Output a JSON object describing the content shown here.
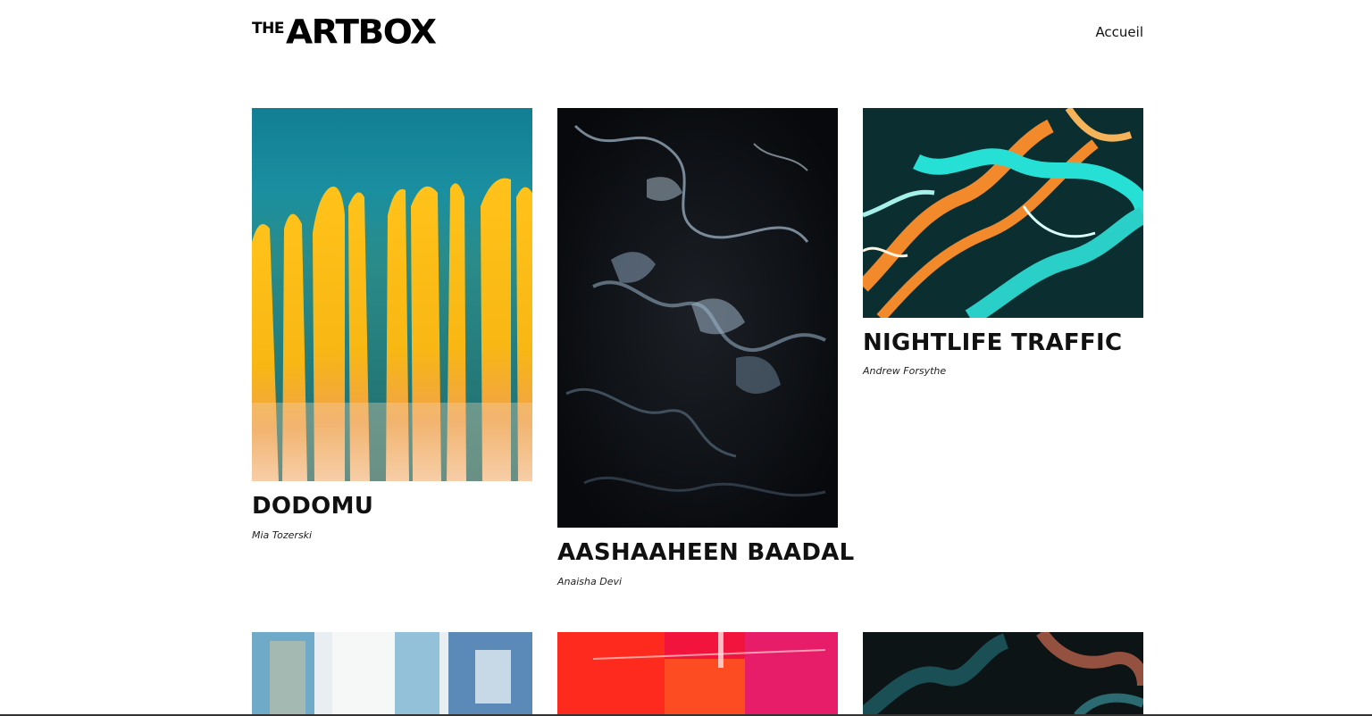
{
  "header": {
    "logo_small": "THE",
    "logo_main": "ARTBOX",
    "nav_home": "Accueil"
  },
  "artworks": [
    {
      "title": "DODOMU",
      "artist": "Mia Tozerski",
      "art_icon": "teal-yellow-drip-painting"
    },
    {
      "title": "AASHAAHEEN BAADAL",
      "artist": "Anaisha Devi",
      "art_icon": "dark-marble-painting"
    },
    {
      "title": "NIGHTLIFE TRAFFIC",
      "artist": "Andrew Forsythe",
      "art_icon": "teal-orange-swirl-painting"
    },
    {
      "title": "",
      "artist": "",
      "art_icon": "blue-white-brush-painting"
    },
    {
      "title": "",
      "artist": "",
      "art_icon": "red-pink-brush-painting"
    },
    {
      "title": "",
      "artist": "",
      "art_icon": "dark-teal-copper-painting"
    }
  ],
  "colors": {
    "background": "#ffffff",
    "text": "#111111"
  }
}
